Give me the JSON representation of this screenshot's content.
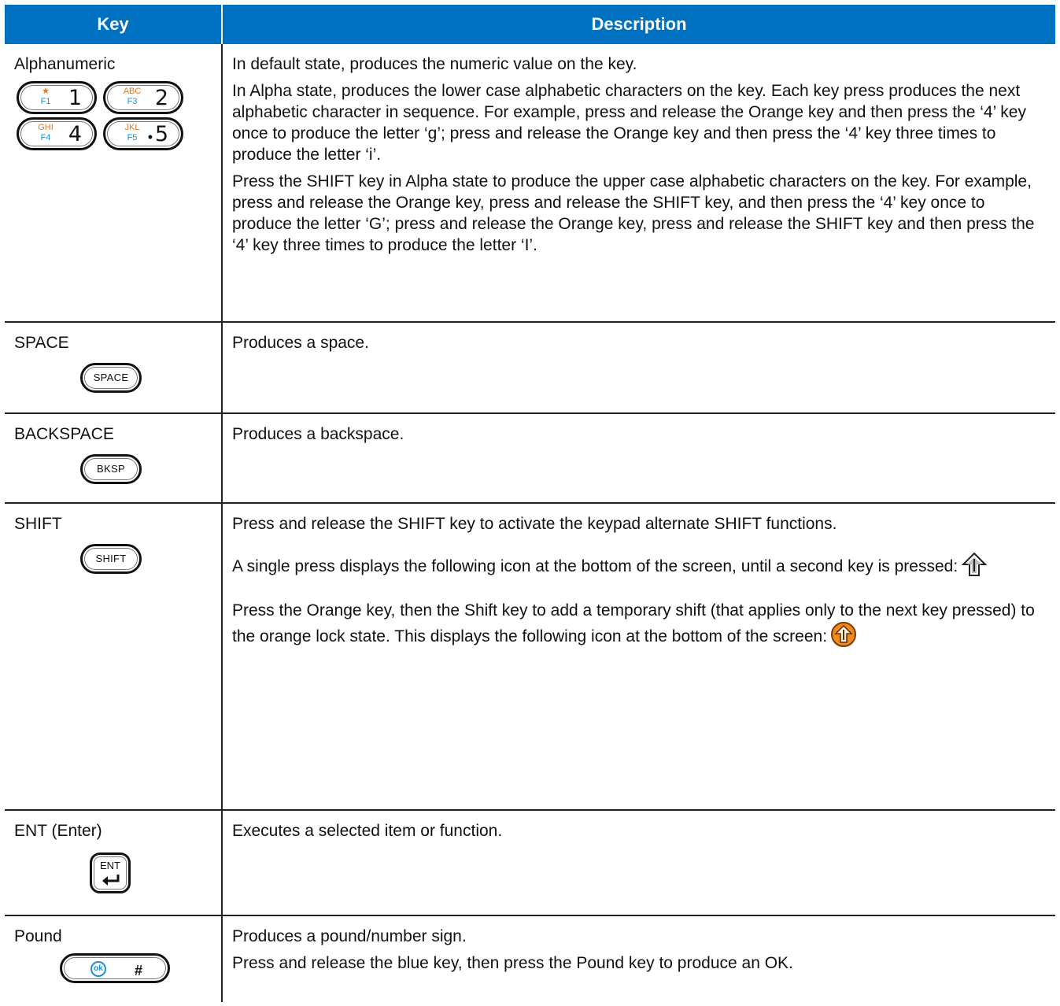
{
  "table": {
    "headers": {
      "key": "Key",
      "description": "Description"
    }
  },
  "rows": {
    "alphanumeric": {
      "key": "Alphanumeric",
      "keys": [
        {
          "alt": "★",
          "fn": "F1",
          "num": "1"
        },
        {
          "alt": "ABC",
          "fn": "F3",
          "num": "2"
        },
        {
          "alt": "GHI",
          "fn": "F4",
          "num": "4"
        },
        {
          "alt": "JKL",
          "fn": "F5",
          "num": "5"
        }
      ],
      "p1": "In default state, produces the numeric value on the key.",
      "p2": "In Alpha state, produces the lower case alphabetic characters on the key. Each key press produces the next alphabetic character in sequence. For example, press and release the Orange key and then press the ‘4’ key once to produce the letter ‘g’; press and release the Orange key and then press the ‘4’ key three times to produce the letter ‘i’.",
      "p3": "Press the SHIFT key in Alpha state to produce the upper case alphabetic characters on the key. For example, press and release the Orange key, press and release the SHIFT key, and then press the ‘4’ key once to produce the letter ‘G’; press and release the Orange key, press and release the SHIFT key and then press the ‘4’ key three times to produce the letter ‘I’."
    },
    "space": {
      "key": "SPACE",
      "key_label": "SPACE",
      "p1": "Produces a space."
    },
    "backspace": {
      "key": "BACKSPACE",
      "key_label": "BKSP",
      "p1": "Produces a backspace."
    },
    "shift": {
      "key": "SHIFT",
      "key_label": "SHIFT",
      "p1": "Press and release the SHIFT key to activate the keypad alternate SHIFT functions.",
      "p2": "A single press displays the following icon at the bottom of the screen, until a second key is pressed:",
      "p3": "Press the Orange key, then the Shift key to add a temporary shift (that applies only to the next key pressed) to the orange lock state. This displays the following icon at the bottom of the screen:"
    },
    "enter": {
      "key": "ENT (Enter)",
      "key_label": "ENT",
      "p1": "Executes a selected item or function."
    },
    "pound": {
      "key": "Pound",
      "ok_label": "ok",
      "hash_label": "#",
      "p1": "Produces a pound/number sign.",
      "p2": "Press and release the blue key, then press the Pound key to produce an OK."
    }
  },
  "colors": {
    "header_bg": "#0070c0",
    "alpha_orange": "#e87722",
    "function_blue": "#1e90d6"
  }
}
